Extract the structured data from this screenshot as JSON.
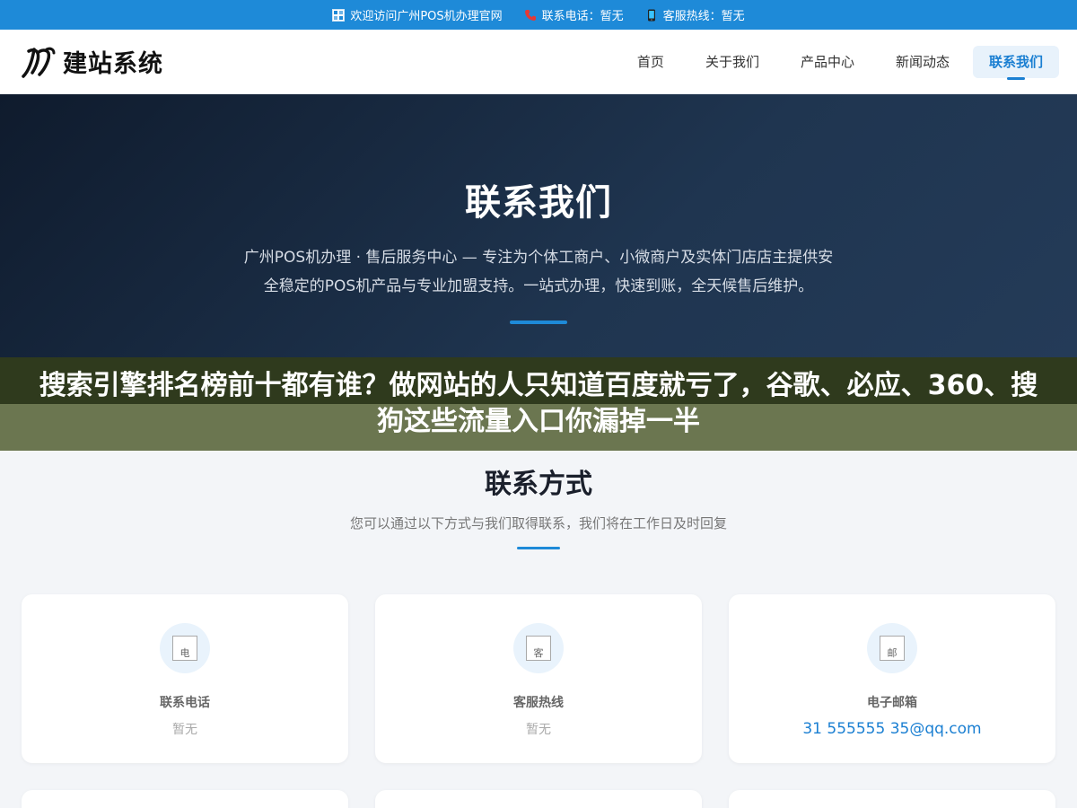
{
  "topbar": {
    "welcome": "欢迎访问广州POS机办理官网",
    "phone": "联系电话：暂无",
    "hotline": "客服热线：暂无"
  },
  "header": {
    "logo_text": "建站系统",
    "nav": [
      "首页",
      "关于我们",
      "产品中心",
      "新闻动态",
      "联系我们"
    ]
  },
  "hero": {
    "title": "联系我们",
    "desc": "广州POS机办理 · 售后服务中心 — 专注为个体工商户、小微商户及实体门店店主提供安全稳定的POS机产品与专业加盟支持。一站式办理，快速到账，全天候售后维护。"
  },
  "banner": {
    "text": "搜索引擎排名榜前十都有谁？做网站的人只知道百度就亏了，谷歌、必应、360、搜狗这些流量入口你漏掉一半"
  },
  "contact": {
    "title": "联系方式",
    "subtitle": "您可以通过以下方式与我们取得联系，我们将在工作日及时回复",
    "cards": [
      {
        "icon_alt": "电",
        "label": "联系电话",
        "value": "暂无"
      },
      {
        "icon_alt": "客",
        "label": "客服热线",
        "value": "暂无"
      },
      {
        "icon_alt": "邮",
        "label": "电子邮箱",
        "value": "31 555555 35@qq.com"
      }
    ]
  },
  "colors": {
    "accent": "#1e8ad8",
    "hero_bg": "#1a2a40"
  },
  "icons": [
    "grid-icon",
    "phone-icon",
    "mobile-icon",
    "logo-mark-icon",
    "broken-image-icon"
  ]
}
